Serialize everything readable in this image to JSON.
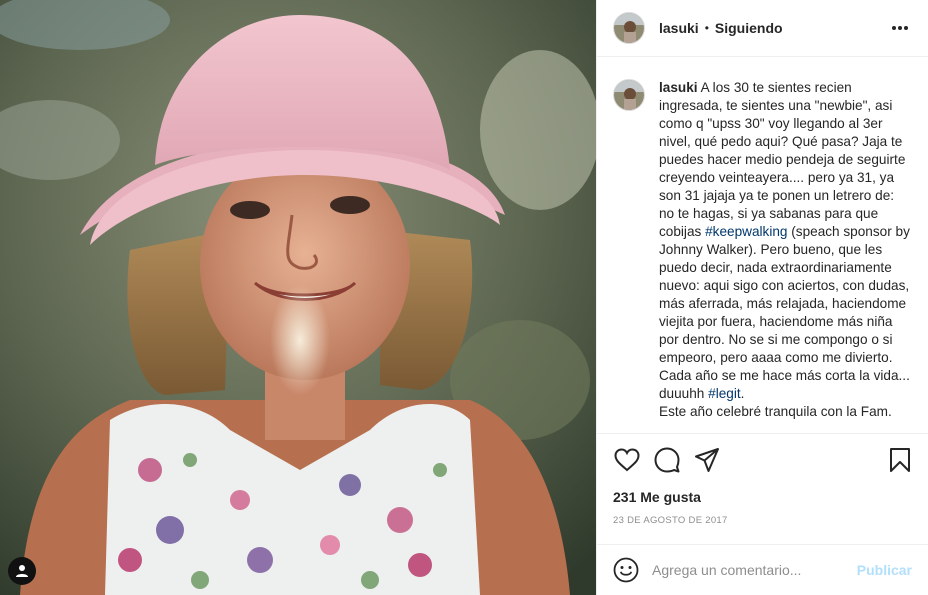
{
  "post": {
    "username": "lasuki",
    "separator": "•",
    "follow_status": "Siguiendo",
    "more_icon": "more-options-icon"
  },
  "caption": {
    "username": "lasuki",
    "line1": "A los 30 te sientes recien ingresada, te sientes una \"newbie\", asi como q \"upss 30\" voy llegando al 3er nivel, qué pedo aqui? Qué pasa? Jaja te puedes hacer medio pendeja de seguirte creyendo veinteayera.... pero ya 31, ya son 31 jajaja ya te ponen un letrero de: no te hagas, si ya sabanas para que cobijas ",
    "hashtag1": "#keepwalking",
    "line2": " (speach sponsor by Johnny Walker). Pero bueno, que les puedo decir, nada extraordinariamente nuevo: aqui sigo con aciertos, con dudas, más aferrada, más relajada, haciendome viejita por fuera, haciendome más niña por dentro. No se si me compongo o si empeoro, pero aaaa como me divierto. Cada año se me hace más corta la vida... duuuhh ",
    "hashtag2": "#legit",
    "line3": ".",
    "line4": "Este año celebré tranquila con la Fam."
  },
  "actions": {
    "like_icon": "heart-icon",
    "comment_icon": "comment-icon",
    "share_icon": "share-icon",
    "save_icon": "bookmark-icon"
  },
  "likes": "231 Me gusta",
  "date": "23 DE AGOSTO DE 2017",
  "comment": {
    "placeholder": "Agrega un comentario...",
    "publish_label": "Publicar",
    "emoji_icon": "emoji-icon"
  },
  "colors": {
    "hashtag": "#00376b",
    "publish_disabled": "#b2dffc",
    "muted": "#8e8e8e"
  }
}
